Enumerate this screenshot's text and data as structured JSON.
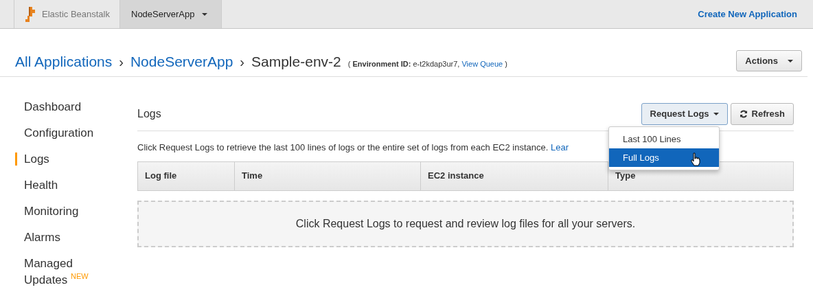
{
  "topbar": {
    "brand": "Elastic Beanstalk",
    "app_menu": "NodeServerApp",
    "create_link": "Create New Application"
  },
  "breadcrumb": {
    "items": [
      {
        "label": "All Applications",
        "separator": "›"
      },
      {
        "label": "NodeServerApp",
        "separator": "›"
      }
    ],
    "current": "Sample-env-2",
    "env_label": "Environment ID:",
    "env_id": "e-t2kdap3ur7,",
    "queue_link": "View Queue",
    "open": "(",
    "close": ")"
  },
  "actions_button": "Actions",
  "sidebar": {
    "items": [
      {
        "label": "Dashboard",
        "selected": false
      },
      {
        "label": "Configuration",
        "selected": false
      },
      {
        "label": "Logs",
        "selected": true
      },
      {
        "label": "Health",
        "selected": false
      },
      {
        "label": "Monitoring",
        "selected": false
      },
      {
        "label": "Alarms",
        "selected": false
      },
      {
        "label": "Managed Updates",
        "selected": false,
        "badge": "NEW"
      }
    ]
  },
  "logs": {
    "title": "Logs",
    "request_button": "Request Logs",
    "refresh_button": "Refresh",
    "menu": [
      {
        "label": "Last 100 Lines",
        "selected": false
      },
      {
        "label": "Full Logs",
        "selected": true
      }
    ],
    "description": "Click Request Logs to retrieve the last 100 lines of logs or the entire set of logs from each EC2 instance.",
    "learn_link": "Lear",
    "table": {
      "columns": [
        "Log file",
        "Time",
        "EC2 instance",
        "Type"
      ]
    },
    "empty_message": "Click Request Logs to request and review log files for all your servers."
  }
}
